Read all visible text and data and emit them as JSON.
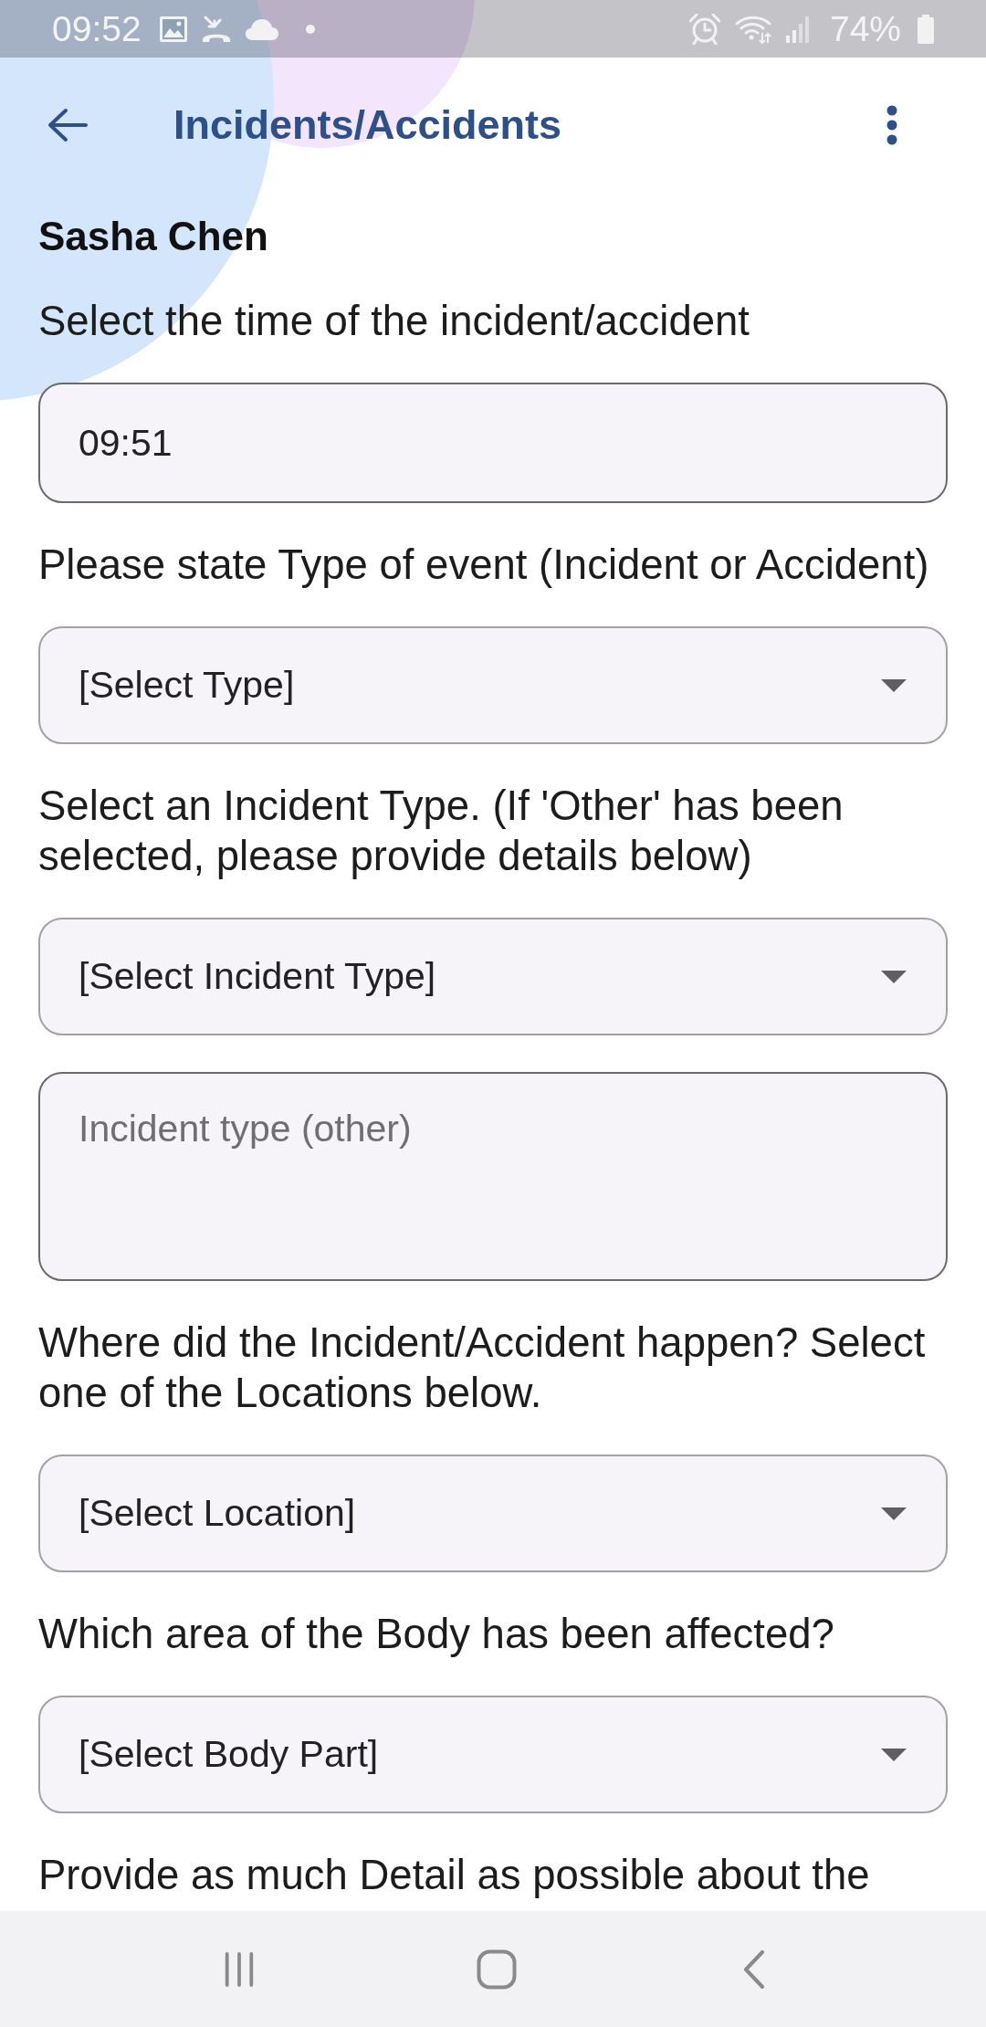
{
  "status_bar": {
    "time": "09:52",
    "battery": "74%"
  },
  "app_bar": {
    "title": "Incidents/Accidents"
  },
  "person": {
    "name": "Sasha Chen"
  },
  "form": [
    {
      "kind": "label",
      "text": "Select the time of the incident/accident"
    },
    {
      "kind": "time_field",
      "value": "09:51"
    },
    {
      "kind": "label",
      "text": "Please state Type of event (Incident or Accident)"
    },
    {
      "kind": "dropdown",
      "value": "[Select Type]"
    },
    {
      "kind": "label",
      "text": "Select an Incident Type. (If 'Other' has been selected, please provide details below)"
    },
    {
      "kind": "dropdown",
      "value": "[Select Incident Type]"
    },
    {
      "kind": "text_area",
      "placeholder": "Incident type (other)"
    },
    {
      "kind": "label",
      "text": "Where did the Incident/Accident happen? Select one of the Locations below."
    },
    {
      "kind": "dropdown",
      "value": "[Select Location]"
    },
    {
      "kind": "label",
      "text": "Which area of the Body has been affected?"
    },
    {
      "kind": "dropdown",
      "value": "[Select Body Part]"
    },
    {
      "kind": "label",
      "text": "Provide as much Detail as possible about the"
    }
  ]
}
